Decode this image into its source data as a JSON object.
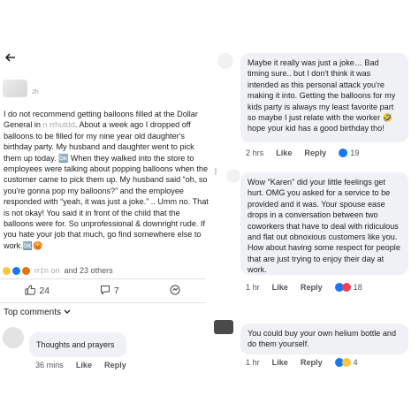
{
  "post": {
    "time": "2h",
    "body_pre": "I do not recommend getting balloons filled at the Dollar General in ",
    "body_blur": "n rrhutdd",
    "body_post": ". About a week ago I dropped off balloons to be filled for my nine year old daughter's birthday party. My husband and daughter went to pick them up today. ",
    "emoji_inline": "🆗",
    "body_post2": " When they walked into the store to employees were talking about popping balloons when the customer came to pick them up. My husband said “oh, so you're gonna pop my balloons?” and the employee responded with “yeah, it was just a joke.” .. Umm no. That is not okay! You said it in front of the child that the balloons were for. So unprofessional & downright rude. If you hate your job that much, go find somewhere else to work.",
    "emoji_end": "🆗😡",
    "reactions_names": "rr‡n on",
    "reactions_text": "and 23 others",
    "likes": "24",
    "comments": "7"
  },
  "top_comments_label": "Top comments",
  "left_comment": {
    "text": "Thoughts and prayers",
    "time": "36 mins",
    "like": "Like",
    "reply": "Reply"
  },
  "right_comments": [
    {
      "text": "Maybe it really was just a joke… Bad timing sure.. but I don't think it was intended as this personal attack you're making it into. Getting the balloons for my kids party is always my least favorite part so maybe I just relate with the worker 🤣 hope your kid has a good birthday tho!",
      "time": "2 hrs",
      "like": "Like",
      "reply": "Reply",
      "reaction_count": "19"
    },
    {
      "text": "Wow \"Karen\" did your little feelings get hurt. OMG you asked for a service to be provided and it was. Your spouse ease drops in a conversation between two coworkers that have to deal with ridiculous and  flat out obnoxious customers like you. How about having some respect for people that are just trying to enjoy their day at work.",
      "time": "1 hr",
      "like": "Like",
      "reply": "Reply",
      "reaction_count": "18"
    },
    {
      "text": "You could buy your own helium bottle and do them yourself.",
      "time": "1 hr",
      "like": "Like",
      "reply": "Reply",
      "reaction_count": "4"
    }
  ],
  "colors": {
    "like_blue": "#1877f2",
    "haha_yellow": "#f7c744",
    "love_red": "#f33e58",
    "bubble_bg": "#eff1f4"
  },
  "icons": [
    "back-arrow-icon",
    "like-icon",
    "comment-icon",
    "share-icon",
    "chevron-down-icon"
  ]
}
